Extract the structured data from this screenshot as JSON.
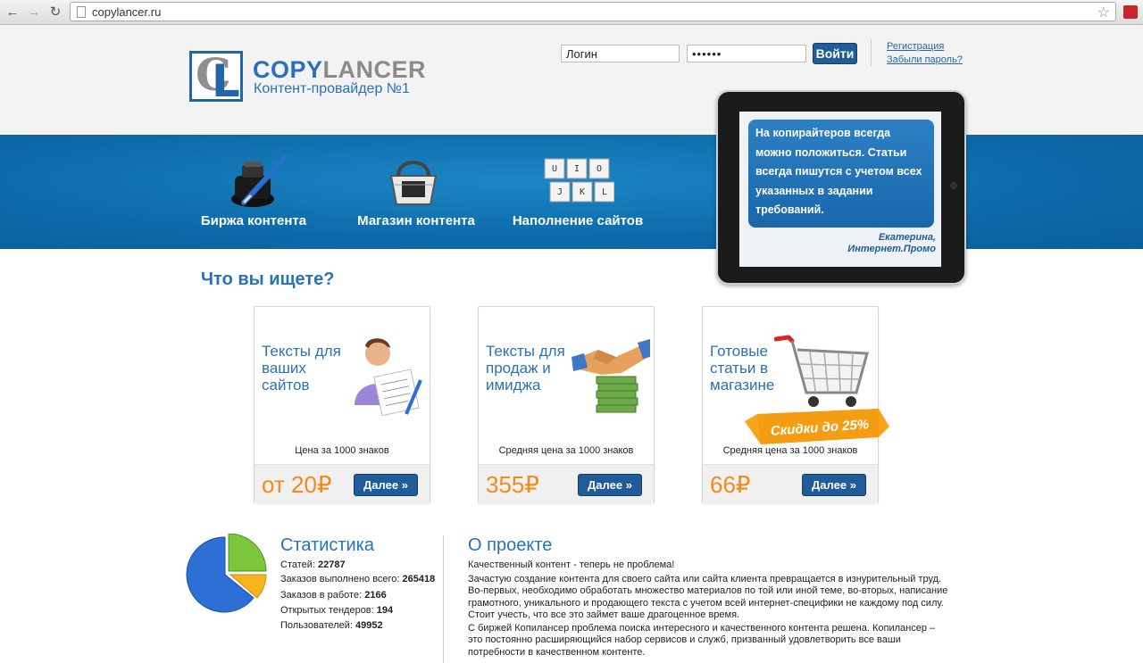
{
  "browser": {
    "url": "copylancer.ru",
    "back_glyph": "←",
    "forward_glyph": "→",
    "reload_glyph": "↻",
    "star_glyph": "☆"
  },
  "header": {
    "logo_name_part1": "COPY",
    "logo_name_part2": "LANCER",
    "logo_mark_c": "C",
    "logo_mark_l": "L",
    "tagline": "Контент-провайдер №1",
    "login_placeholder": "Логин",
    "login_value": "Логин",
    "password_value": "••••••",
    "login_button": "Войти",
    "register_link": "Регистрация",
    "forgot_link": "Забыли пароль?"
  },
  "services": [
    {
      "label": "Биржа контента",
      "icon": "inkwell-pen-icon"
    },
    {
      "label": "Магазин контента",
      "icon": "shopping-basket-icon"
    },
    {
      "label": "Наполнение сайтов",
      "icon": "keyboard-keys-icon"
    }
  ],
  "keys": [
    "U",
    "I",
    "O",
    "J",
    "K",
    "L"
  ],
  "testimonial": {
    "text": "На копирайтеров всегда можно положиться. Статьи всегда пишутся с учетом всех указанных в задании требований.",
    "author_name": "Екатерина,",
    "author_company": "Интернет.Промо"
  },
  "main": {
    "section_title": "Что вы ищете?",
    "cards": [
      {
        "title": "Тексты для\nваших\nсайтов",
        "note": "Цена за 1000 знаков",
        "price": "от 20₽",
        "button": "Далее »",
        "icon": "person-document-icon"
      },
      {
        "title": "Тексты для\nпродаж и\nимиджа",
        "note": "Средняя цена за 1000 знаков",
        "price": "355₽",
        "button": "Далее »",
        "icon": "handshake-money-icon"
      },
      {
        "title": "Готовые\nстатьи в\nмагазине",
        "note": "Средняя цена за 1000 знаков",
        "price": "66₽",
        "button": "Далее »",
        "icon": "shopping-cart-icon"
      }
    ],
    "sale_ribbon": "Скидки до 25%"
  },
  "stats": {
    "title": "Статистика",
    "rows": [
      {
        "label": "Статей: ",
        "value": "22787"
      },
      {
        "label": "Заказов выполнено всего: ",
        "value": "265418"
      },
      {
        "label": "Заказов в работе: ",
        "value": "2166"
      },
      {
        "label": "Открытых тендеров: ",
        "value": "194"
      },
      {
        "label": "Пользователей: ",
        "value": "49952"
      }
    ]
  },
  "about": {
    "title": "О проекте",
    "p1": "Качественный контент - теперь не проблема!",
    "p2": "Зачастую создание контента для своего сайта или сайта клиента превращается в изнурительный труд. Во-первых, необходимо обработать множество материалов по той или иной теме, во-вторых, написание грамотного, уникального и продающего текста с учетом всей интернет-специфики не каждому под силу. Стоит учесть, что все это займет ваше драгоценное время.",
    "p3": "С биржей Копилансер проблема поиска интересного и качественного контента решена. Копилансер – это постоянно расширяющийся набор сервисов и служб, призванный удовлетворить все ваши потребности в качественном контенте."
  },
  "colors": {
    "brand_blue": "#2a71b8",
    "band_blue": "#0d6aa8",
    "button_blue": "#1f5c99",
    "price_orange": "#f28a1c"
  }
}
